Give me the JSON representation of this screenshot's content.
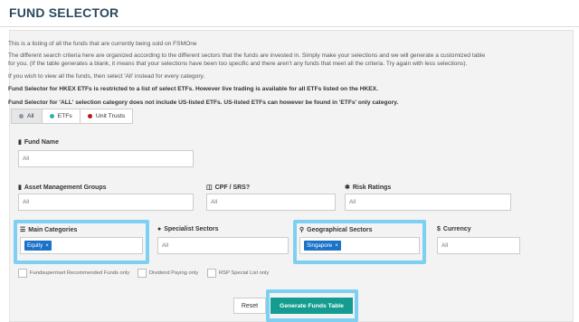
{
  "header": {
    "title": "FUND SELECTOR"
  },
  "intro": {
    "line1": "This is a listing of all the funds that are currently being sold on FSMOne",
    "line2": "The different search criteria here are organized according to the different sectors that the funds are invested in. Simply make your selections and we will generate a customized table",
    "line3": "for you. (If the table generates a blank, it means that your selections have been too specific and there aren't any funds that meet all the criteria. Try again with less selections).",
    "line4": "If you wish to view all the funds, then select 'All' instead for every category.",
    "note1": "Fund Selector for HKEX ETFs is restricted to a list of select ETFs. However live trading is available for all ETFs listed on the HKEX.",
    "note2": "Fund Selector for 'ALL' selection category does not include US-listed ETFs. US-listed ETFs can however be found in 'ETFs' only category."
  },
  "tabs": [
    {
      "label": "All",
      "color": "#8a9aa8"
    },
    {
      "label": "ETFs",
      "color": "#2ab0b8"
    },
    {
      "label": "Unit Trusts",
      "color": "#b11d1d"
    }
  ],
  "fields": {
    "fund_name": {
      "label": "Fund Name",
      "placeholder": "All",
      "icon": "list-icon"
    },
    "amg": {
      "label": "Asset Management Groups",
      "placeholder": "All",
      "icon": "building-icon"
    },
    "cpf": {
      "label": "CPF / SRS?",
      "placeholder": "All",
      "icon": "cpf-icon"
    },
    "risk": {
      "label": "Risk Ratings",
      "placeholder": "All",
      "icon": "asterisk-icon"
    },
    "main_cat": {
      "label": "Main Categories",
      "chip": "Equity",
      "icon": "grid-icon"
    },
    "specialist": {
      "label": "Specialist Sectors",
      "placeholder": "All",
      "icon": "user-icon"
    },
    "geo": {
      "label": "Geographical Sectors",
      "chip": "Singapore",
      "icon": "pin-icon"
    },
    "currency": {
      "label": "Currency",
      "placeholder": "All",
      "icon": "dollar-icon"
    }
  },
  "checkboxes": [
    {
      "label": "Fundsupermart Recommended Funds only"
    },
    {
      "label": "Dividend Paying only"
    },
    {
      "label": "RSP Special List only"
    }
  ],
  "buttons": {
    "reset": "Reset",
    "generate": "Generate Funds Table"
  },
  "colors": {
    "highlight": "#7dd0f2",
    "generate": "#139c8f",
    "chip": "#1a73c8"
  }
}
